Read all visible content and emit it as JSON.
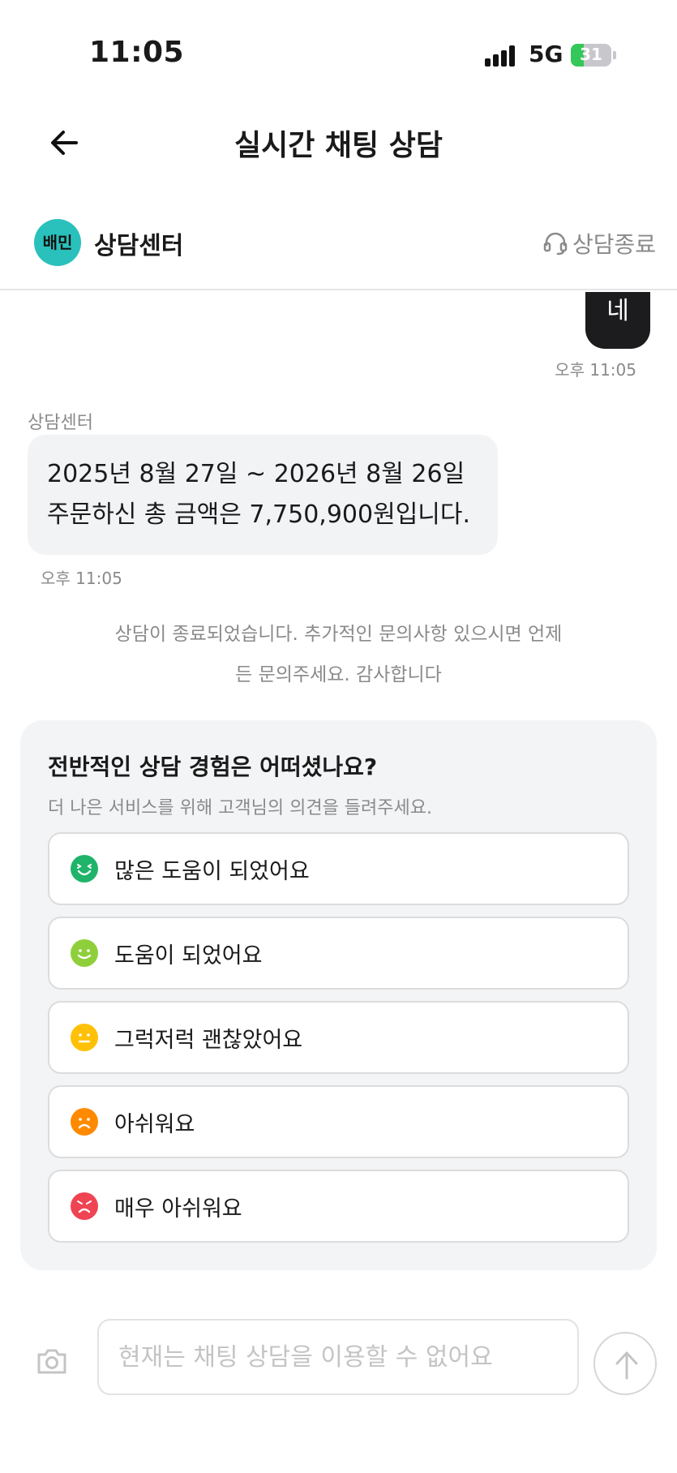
{
  "status_bar": {
    "time": "11:05",
    "network": "5G",
    "battery": "31",
    "battery_level": 0.31
  },
  "nav": {
    "title": "실시간 채팅 상담"
  },
  "agent_header": {
    "logo_text": "배민",
    "name": "상담센터",
    "end_chat_label": "상담종료",
    "brand_color": "#2ac1bc"
  },
  "messages": {
    "user": {
      "text": "네",
      "time": "오후 11:05"
    },
    "agent": {
      "sender": "상담센터",
      "line1": "2025년 8월 27일 ~ 2026년 8월 26일",
      "line2": "주문하신 총 금액은 7,750,900원입니다.",
      "time": "오후 11:05"
    }
  },
  "system_notice": {
    "line1": "상담이 종료되었습니다. 추가적인 문의사항 있으시면 언제",
    "line2": "든 문의주세요. 감사합니다"
  },
  "survey": {
    "title": "전반적인 상담 경험은 어떠셨나요?",
    "subtitle": "더 나은 서비스를 위해 고객님의 의견을 들려주세요.",
    "options": [
      {
        "label": "많은 도움이 되었어요",
        "icon": "very-happy-face-icon",
        "color": "#1fb46a"
      },
      {
        "label": "도움이 되었어요",
        "icon": "happy-face-icon",
        "color": "#8fcf3c"
      },
      {
        "label": "그럭저럭 괜찮았어요",
        "icon": "neutral-face-icon",
        "color": "#ffc107"
      },
      {
        "label": "아쉬워요",
        "icon": "sad-face-icon",
        "color": "#ff8a00"
      },
      {
        "label": "매우 아쉬워요",
        "icon": "angry-face-icon",
        "color": "#f04452"
      }
    ]
  },
  "input_bar": {
    "placeholder": "현재는 채팅 상담을 이용할 수 없어요"
  }
}
